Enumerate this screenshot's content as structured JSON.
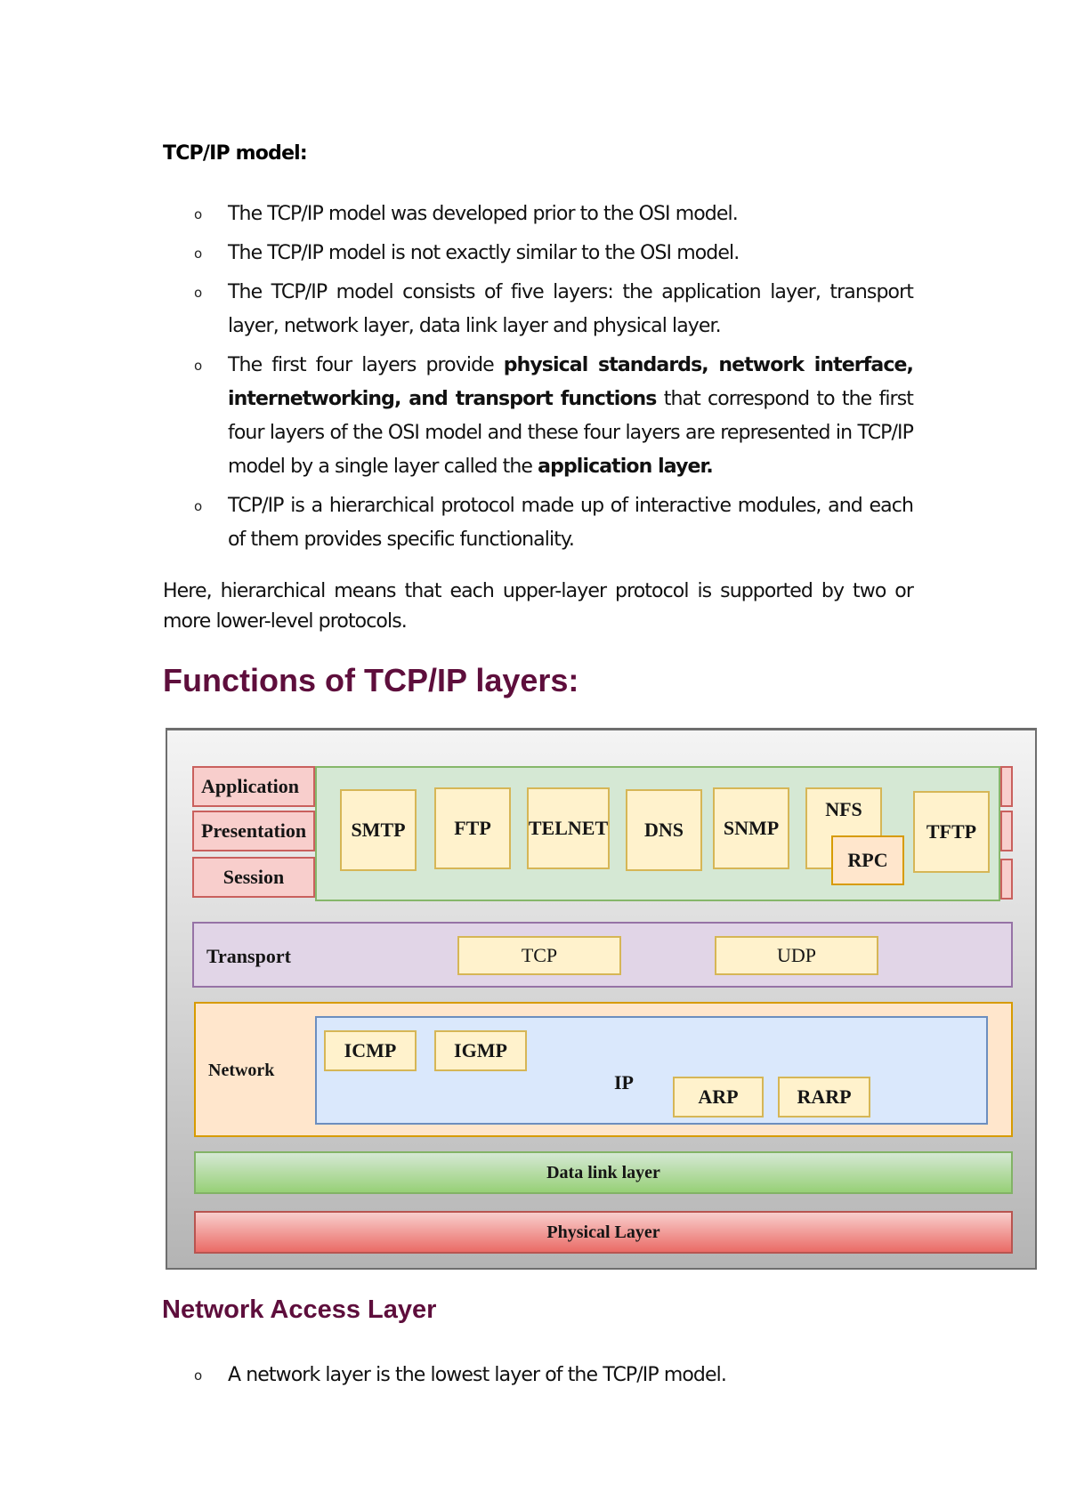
{
  "document": {
    "section_heading": "TCP/IP model:",
    "bullets": [
      {
        "text": "The TCP/IP model was developed prior to the OSI model."
      },
      {
        "text": "The TCP/IP model is not exactly similar to the OSI model."
      },
      {
        "text": "The TCP/IP model consists of five layers: the application layer, transport layer, network layer, data link layer and physical layer."
      },
      {
        "part1": "The first four layers provide ",
        "bold1": "physical standards, network interface, internetworking, and transport functions",
        "part2": " that correspond to the first four layers of the OSI model and these four layers are represented in TCP/IP model by a single layer called the ",
        "bold2": "application layer."
      },
      {
        "text": "TCP/IP is a hierarchical protocol made up of interactive modules, and each of them provides specific functionality."
      }
    ],
    "paragraph": "Here, hierarchical means that each upper-layer protocol is supported by two or more lower-level protocols.",
    "functions_title": "Functions of TCP/IP layers:",
    "network_access_title": "Network Access Layer",
    "network_access_bullets": [
      "A network layer is the lowest layer of the TCP/IP model."
    ],
    "bullet_glyph": "o"
  },
  "diagram": {
    "osi_labels": [
      "Application",
      "Presentation",
      "Session"
    ],
    "app_protocols": [
      "SMTP",
      "FTP",
      "TELNET",
      "DNS",
      "SNMP",
      "NFS",
      "TFTP"
    ],
    "rpc": "RPC",
    "transport": {
      "label": "Transport",
      "protocols": [
        "TCP",
        "UDP"
      ]
    },
    "network": {
      "label": "Network",
      "ip_label": "IP",
      "protocols": [
        "ICMP",
        "IGMP",
        "ARP",
        "RARP"
      ]
    },
    "data_link": "Data link layer",
    "physical": "Physical Layer"
  },
  "colors": {
    "heading_color": "#5e0e3c",
    "osi_layer_fill": "#f8cecc",
    "application_panel": "#d5e8d4",
    "protocol_box": "#fff2cc",
    "transport_panel": "#e1d5e7",
    "network_panel": "#ffe6cc",
    "ip_panel": "#dae8fc"
  }
}
